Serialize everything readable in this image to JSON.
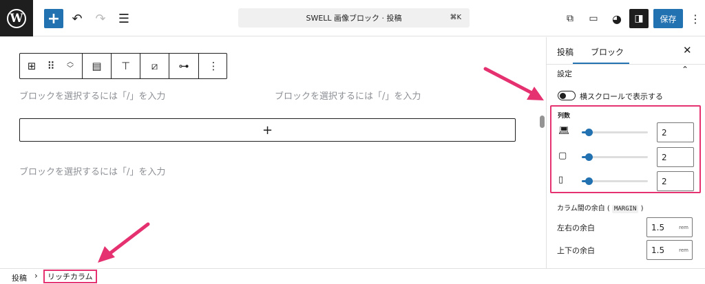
{
  "topbar": {
    "logo_letter": "W",
    "command_bar": "SWELL 画像ブロック · 投稿",
    "command_shortcut": "⌘K",
    "save_label": "保存"
  },
  "canvas": {
    "placeholders": [
      "ブロックを選択するには「/」を入力",
      "ブロックを選択するには「/」を入力",
      "ブロックを選択するには「/」を入力"
    ],
    "appender_label": "+"
  },
  "sidebar": {
    "tabs": [
      "投稿",
      "ブロック"
    ],
    "active_tab": "ブロック",
    "section_title": "設定",
    "toggle_label": "横スクロールで表示する",
    "toggle_on": false,
    "columns_label": "列数",
    "devices": [
      {
        "icon": "laptop-icon",
        "value": "2",
        "slider_fraction": 0.1
      },
      {
        "icon": "tablet-icon",
        "value": "2",
        "slider_fraction": 0.1
      },
      {
        "icon": "phone-icon",
        "value": "2",
        "slider_fraction": 0.1
      }
    ],
    "margin_heading": "カラム間の余白 (",
    "margin_code": "MARGIN",
    "margin_heading_close": ")",
    "gaps": [
      {
        "label": "左右の余白",
        "value": "1.5",
        "unit": "rem"
      },
      {
        "label": "上下の余白",
        "value": "1.5",
        "unit": "rem"
      }
    ]
  },
  "breadcrumb": {
    "root": "投稿",
    "separator": "›",
    "current": "リッチカラム"
  },
  "colors": {
    "accent": "#2271b1",
    "highlight": "#e5316f"
  }
}
